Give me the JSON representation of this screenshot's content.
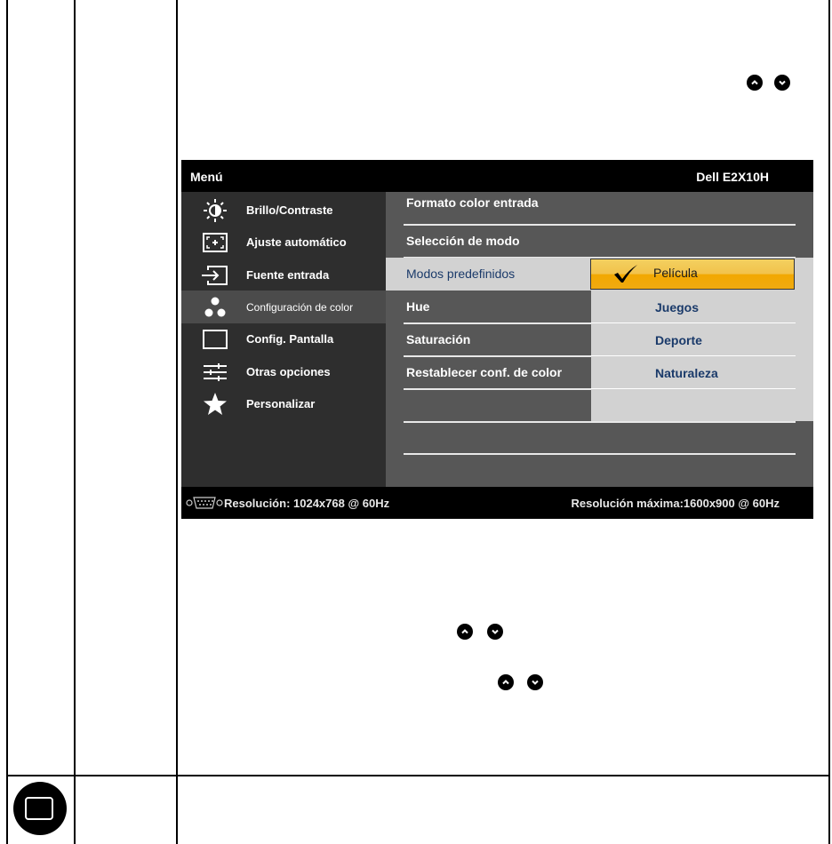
{
  "osd": {
    "title": "Menú",
    "model": "Dell E2X10H",
    "menu": [
      {
        "label": "Brillo/Contraste",
        "icon": "brightness-contrast-icon"
      },
      {
        "label": "Ajuste  automático",
        "icon": "auto-adjust-icon"
      },
      {
        "label": "Fuente entrada",
        "icon": "input-source-icon"
      },
      {
        "label": "Configuración de color",
        "icon": "color-settings-icon",
        "active": true
      },
      {
        "label": "Config. Pantalla",
        "icon": "display-settings-icon"
      },
      {
        "label": "Otras opciones",
        "icon": "other-settings-icon"
      },
      {
        "label": "Personalizar",
        "icon": "star-icon"
      }
    ],
    "rows": [
      {
        "label": "Formato color entrada"
      },
      {
        "label": "Selección de modo"
      },
      {
        "label": "Modos predefinidos",
        "selected": true
      },
      {
        "label": "Hue"
      },
      {
        "label": "Saturación"
      },
      {
        "label": "Restablecer conf. de color"
      }
    ],
    "options": [
      {
        "label": "Película",
        "checked": true
      },
      {
        "label": "Juegos"
      },
      {
        "label": "Deporte"
      },
      {
        "label": "Naturaleza"
      }
    ],
    "footer": {
      "resolution": "Resolución: 1024x768 @ 60Hz",
      "max_resolution": "Resolución máxima:1600x900 @ 60Hz"
    }
  },
  "icons": {
    "nav_up": "chevron-up-icon",
    "nav_down": "chevron-down-icon",
    "bottom": "menu-button-icon"
  },
  "colors": {
    "highlight": "#f2a800",
    "option_text": "#1a3a6a"
  }
}
